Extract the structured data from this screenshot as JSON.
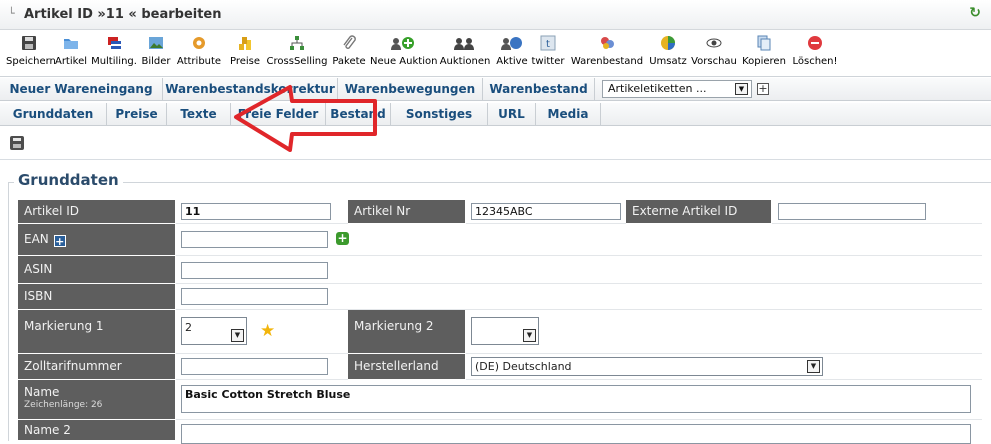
{
  "window": {
    "tree_glyph": "└",
    "title": "Artikel ID »11 « bearbeiten",
    "refresh_icon": "↻"
  },
  "toolbar": {
    "items": [
      {
        "label": "Speichern",
        "icon": "save-icon"
      },
      {
        "label": "Artikel",
        "icon": "folder-icon"
      },
      {
        "label": "Multiling.",
        "icon": "flags-icon"
      },
      {
        "label": "Bilder",
        "icon": "image-icon"
      },
      {
        "label": "Attribute",
        "icon": "attribute-icon"
      },
      {
        "label": "Preise",
        "icon": "price-icon"
      },
      {
        "label": "CrossSelling",
        "icon": "crossselling-icon"
      },
      {
        "label": "Pakete",
        "icon": "paperclip-icon"
      },
      {
        "label": "Neue Auktion",
        "icon": "add-auction-icon"
      },
      {
        "label": "Auktionen",
        "icon": "auctions-icon"
      },
      {
        "label": "Aktive",
        "icon": "active-icon"
      },
      {
        "label": "twitter",
        "icon": "twitter-icon"
      },
      {
        "label": "Warenbestand",
        "icon": "stock-icon"
      },
      {
        "label": "Umsatz",
        "icon": "revenue-icon"
      },
      {
        "label": "Vorschau",
        "icon": "eye-icon"
      },
      {
        "label": "Kopieren",
        "icon": "copy-icon"
      },
      {
        "label": "Löschen!",
        "icon": "delete-icon"
      }
    ]
  },
  "nav1": {
    "items": [
      "Neuer Wareneingang",
      "Warenbestandskorrektur",
      "Warenbewegungen",
      "Warenbestand"
    ],
    "select_value": "Artikeletiketten ...",
    "plus": "+"
  },
  "nav2": {
    "tabs": [
      "Grunddaten",
      "Preise",
      "Texte",
      "Freie Felder",
      "Bestand",
      "Sonstiges",
      "URL",
      "Media"
    ]
  },
  "form": {
    "legend": "Grunddaten",
    "artikel_id_label": "Artikel ID",
    "artikel_id_value": "11",
    "artikel_nr_label": "Artikel Nr",
    "artikel_nr_value": "12345ABC",
    "externe_label": "Externe Artikel ID",
    "externe_value": "",
    "ean_label": "EAN",
    "ean_value": "",
    "asin_label": "ASIN",
    "asin_value": "",
    "isbn_label": "ISBN",
    "isbn_value": "",
    "markierung1_label": "Markierung 1",
    "markierung1_value": "2",
    "markierung2_label": "Markierung 2",
    "markierung2_value": "",
    "zoll_label": "Zolltarifnummer",
    "zoll_value": "",
    "herstellerland_label": "Herstellerland",
    "herstellerland_value": "(DE) Deutschland",
    "name_label": "Name",
    "name_sub": "Zeichenlänge: 26",
    "name_value": "Basic Cotton Stretch Bluse",
    "name2_label": "Name 2",
    "name2_value": ""
  },
  "colors": {
    "label_bg": "#5e5e5e",
    "nav_text": "#1a4e7d",
    "arrow_red": "#e0262a"
  }
}
